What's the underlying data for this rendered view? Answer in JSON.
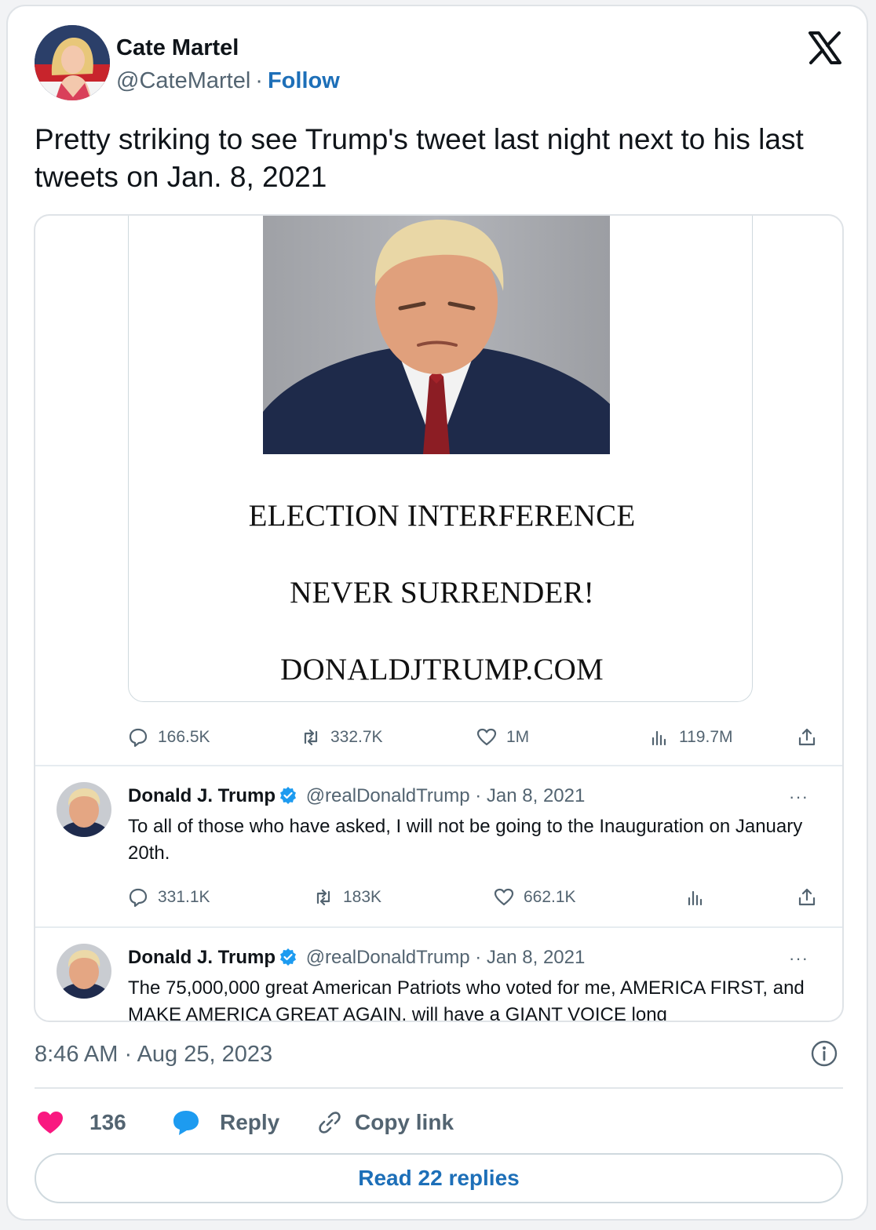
{
  "author": {
    "name": "Cate Martel",
    "handle": "@CateMartel",
    "separator": "·",
    "follow_label": "Follow"
  },
  "tweet": {
    "text": "Pretty striking to see Trump's tweet last night next to his last tweets on Jan. 8, 2021",
    "timestamp": "8:46 AM · Aug 25, 2023"
  },
  "embedded_post": {
    "lines": [
      "ELECTION INTERFERENCE",
      "NEVER SURRENDER!",
      "DONALDJTRUMP.COM"
    ],
    "stats": {
      "replies": "166.5K",
      "reposts": "332.7K",
      "likes": "1M",
      "views": "119.7M"
    }
  },
  "old_tweets": [
    {
      "name": "Donald J. Trump",
      "handle": "@realDonaldTrump",
      "date_line": "· Jan 8, 2021",
      "more": "···",
      "text": "To all of those who have asked, I will not be going to the Inauguration on January 20th.",
      "stats": {
        "replies": "331.1K",
        "reposts": "183K",
        "likes": "662.1K"
      }
    },
    {
      "name": "Donald J. Trump",
      "handle": "@realDonaldTrump",
      "date_line": "· Jan 8, 2021",
      "more": "···",
      "text": "The 75,000,000 great American Patriots who voted for me, AMERICA FIRST, and MAKE AMERICA GREAT AGAIN, will have a GIANT VOICE long"
    }
  ],
  "footer": {
    "like_count": "136",
    "reply_label": "Reply",
    "copy_link_label": "Copy link",
    "read_replies_label": "Read 22 replies"
  },
  "colors": {
    "link_blue": "#1d6fb8",
    "like_pink": "#f91880",
    "reply_blue": "#1d9bf0",
    "muted_text": "#536471"
  },
  "icons": [
    "x-logo-icon",
    "verified-badge-icon",
    "reply-icon",
    "repost-icon",
    "heart-icon",
    "views-icon",
    "share-icon",
    "info-icon",
    "link-icon",
    "chat-bubble-icon"
  ]
}
